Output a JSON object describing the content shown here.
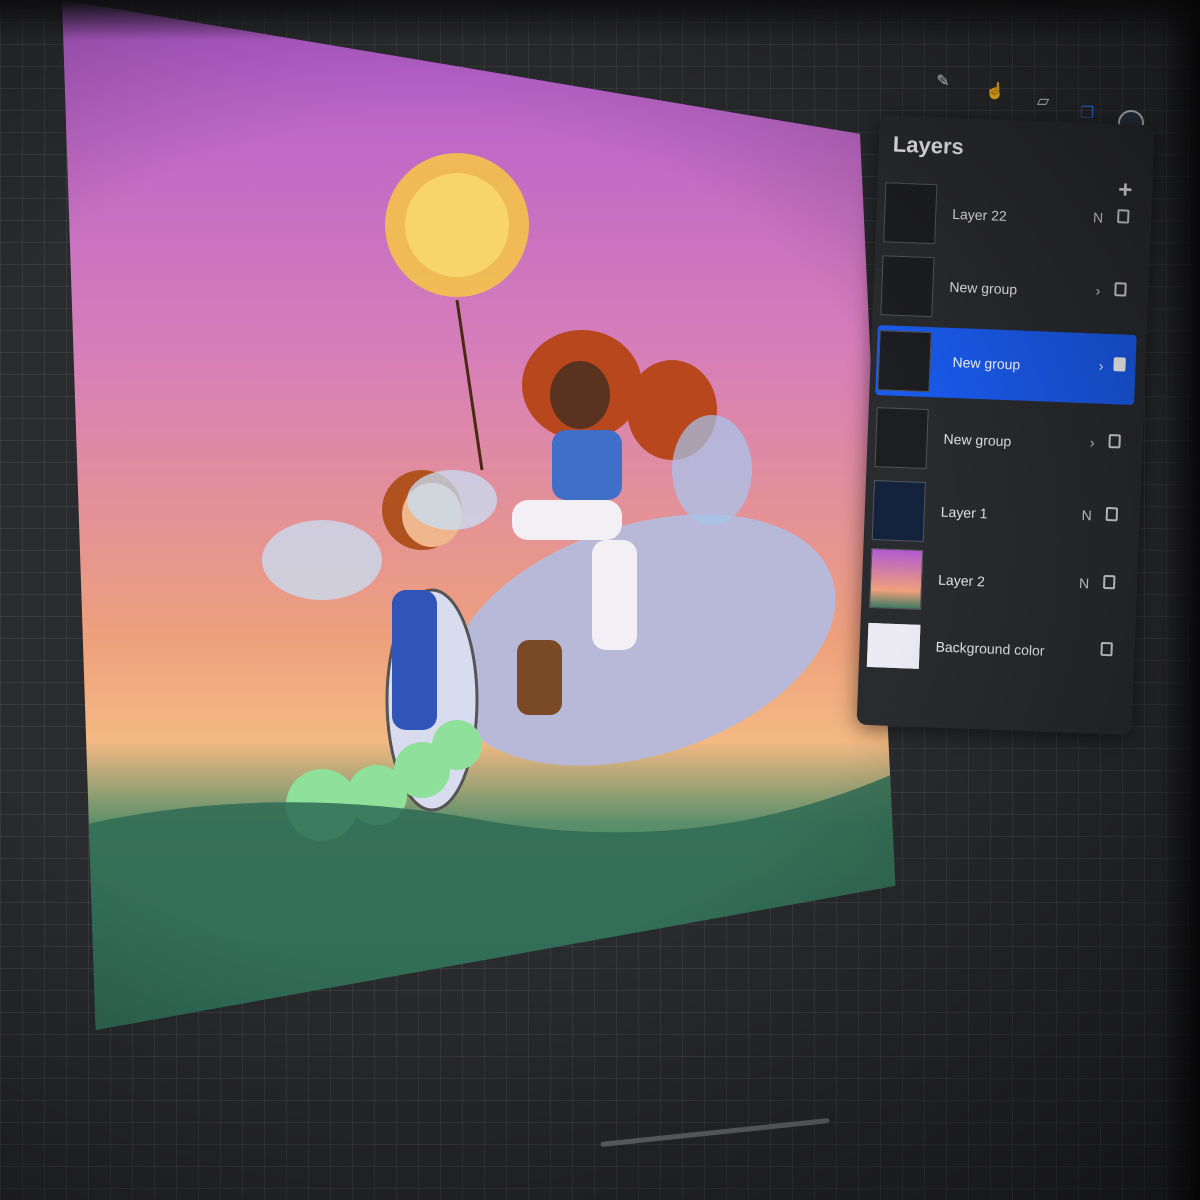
{
  "toolbar": {
    "tools": [
      {
        "name": "brush-icon",
        "glyph": "✎"
      },
      {
        "name": "smudge-icon",
        "glyph": "☝"
      },
      {
        "name": "eraser-icon",
        "glyph": "▱"
      },
      {
        "name": "layers-icon",
        "glyph": "❐"
      }
    ],
    "accent_color": "#1a5cf0"
  },
  "layers_panel": {
    "title": "Layers",
    "add_glyph": "+",
    "layers": [
      {
        "label": "Layer 22",
        "selected": false,
        "kind": "layer",
        "marker": "N"
      },
      {
        "label": "New group",
        "selected": false,
        "kind": "group",
        "marker": "›"
      },
      {
        "label": "New group",
        "selected": true,
        "kind": "group",
        "marker": "›"
      },
      {
        "label": "New group",
        "selected": false,
        "kind": "group",
        "marker": "›"
      },
      {
        "label": "Layer 1",
        "selected": false,
        "kind": "layer",
        "marker": "N"
      },
      {
        "label": "Layer 2",
        "selected": false,
        "kind": "layer",
        "marker": "N"
      },
      {
        "label": "Background color",
        "selected": false,
        "kind": "background",
        "marker": ""
      }
    ]
  }
}
